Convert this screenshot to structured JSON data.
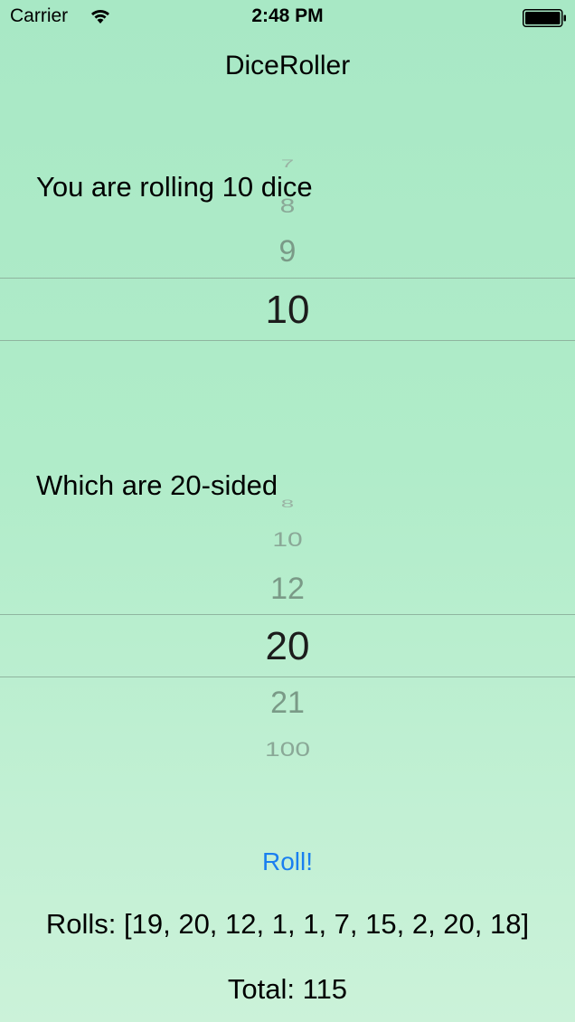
{
  "status_bar": {
    "carrier": "Carrier",
    "time": "2:48 PM",
    "icons": [
      "wifi-icon",
      "battery-icon"
    ]
  },
  "nav": {
    "title": "DiceRoller"
  },
  "dice_count": {
    "label": "You are rolling 10 dice",
    "rows": {
      "far_above_2": "7",
      "far_above": "8",
      "above": "9",
      "selected": "10"
    }
  },
  "dice_sides": {
    "label": "Which are 20-sided",
    "rows": {
      "far_above_2": "8",
      "far_above": "10",
      "above": "12",
      "selected": "20",
      "below": "21",
      "far_below": "100"
    }
  },
  "roll_button": {
    "label": "Roll!",
    "color": "#1a7ff0"
  },
  "results": {
    "rolls": "Rolls: [19, 20, 12, 1, 1, 7, 15, 2, 20, 18]",
    "total": "Total: 115"
  }
}
